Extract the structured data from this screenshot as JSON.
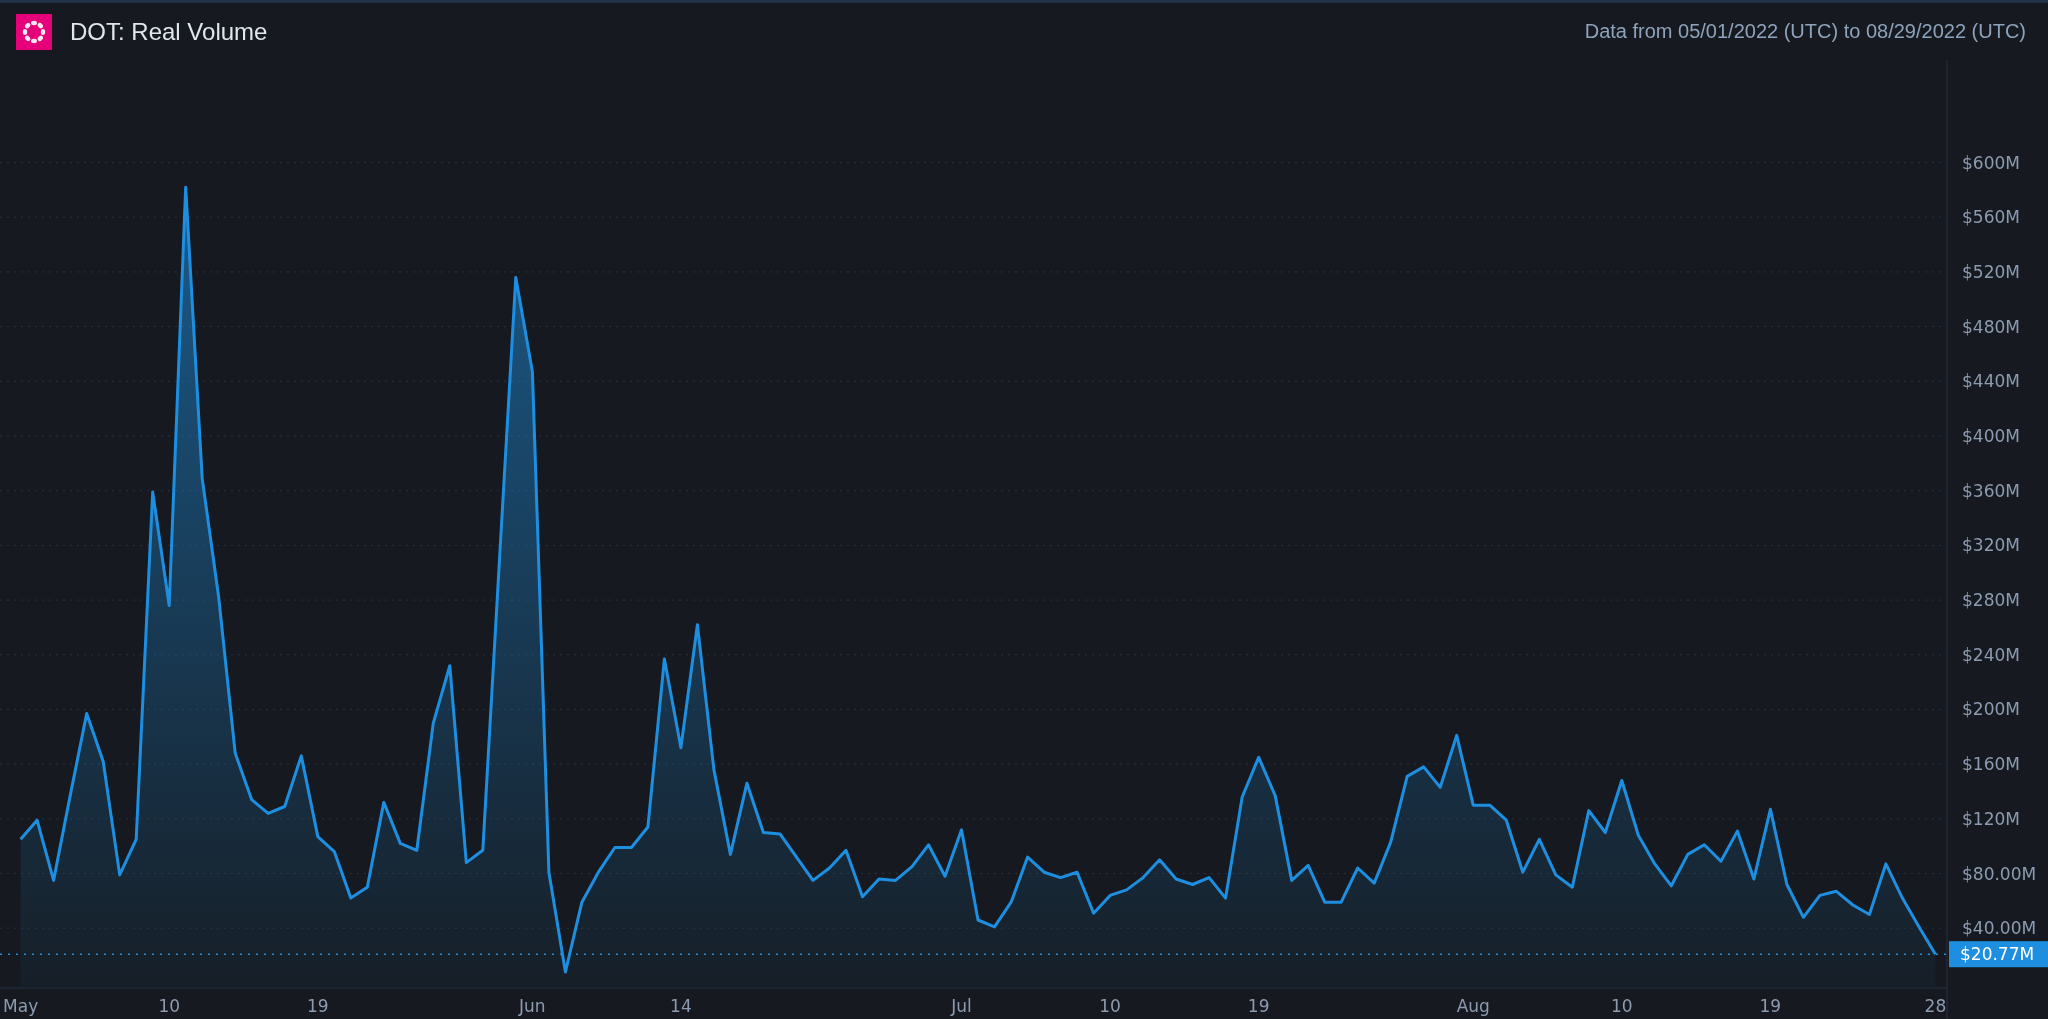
{
  "header": {
    "title": "DOT: Real Volume",
    "date_range": "Data from 05/01/2022 (UTC) to 08/29/2022 (UTC)"
  },
  "chart": {
    "chart_data": {
      "type": "area",
      "grid": true,
      "categories": [
        "May",
        null,
        null,
        null,
        null,
        null,
        null,
        null,
        null,
        "10",
        null,
        null,
        null,
        null,
        null,
        null,
        null,
        null,
        "19",
        null,
        null,
        null,
        null,
        null,
        null,
        null,
        null,
        null,
        null,
        null,
        null,
        "Jun",
        null,
        null,
        null,
        null,
        null,
        null,
        null,
        null,
        "14",
        null,
        null,
        null,
        null,
        null,
        null,
        null,
        null,
        null,
        null,
        null,
        null,
        null,
        null,
        null,
        null,
        "Jul",
        null,
        null,
        null,
        null,
        null,
        null,
        null,
        null,
        "10",
        null,
        null,
        null,
        null,
        null,
        null,
        null,
        null,
        "19",
        null,
        null,
        null,
        null,
        null,
        null,
        null,
        null,
        null,
        null,
        null,
        null,
        "Aug",
        null,
        null,
        null,
        null,
        null,
        null,
        null,
        null,
        "10",
        null,
        null,
        null,
        null,
        null,
        null,
        null,
        null,
        "19",
        null,
        null,
        null,
        null,
        null,
        null,
        null,
        null,
        null,
        "28"
      ],
      "ref_lines": [
        {
          "axis": "y",
          "value": 21,
          "label": "$20.77M",
          "color": "#1e8fe0"
        }
      ],
      "series": [
        {
          "color": "#1e8fe0",
          "values": [
            105,
            119,
            75,
            137,
            197,
            162,
            79,
            105,
            359,
            276,
            582,
            369,
            282,
            168,
            134,
            124,
            129,
            166,
            107,
            96,
            62,
            70,
            132,
            102,
            97,
            190,
            232,
            88,
            97,
            307,
            516,
            447,
            81,
            8,
            59,
            81,
            99,
            99,
            114,
            237,
            172,
            262,
            156,
            94,
            146,
            110,
            109,
            92,
            75,
            84,
            97,
            63,
            76,
            75,
            85,
            101,
            78,
            112,
            46,
            41,
            59,
            92,
            81,
            77,
            81,
            51,
            64,
            68,
            77,
            90,
            76,
            72,
            77,
            62,
            136,
            165,
            137,
            75,
            86,
            59,
            59,
            84,
            73,
            103,
            151,
            158,
            143,
            181,
            130,
            130,
            119,
            81,
            105,
            79,
            70,
            126,
            110,
            148,
            108,
            87,
            71,
            94,
            101,
            89,
            111,
            76,
            127,
            72,
            48,
            64,
            67,
            57,
            50,
            87,
            62,
            41,
            21
          ]
        }
      ],
      "ylim": [
        -3,
        675
      ],
      "yticks": [
        {
          "value": 40,
          "label": "$40.00M"
        },
        {
          "value": 80,
          "label": "$80.00M"
        },
        {
          "value": 120,
          "label": "$120M"
        },
        {
          "value": 160,
          "label": "$160M"
        },
        {
          "value": 200,
          "label": "$200M"
        },
        {
          "value": 240,
          "label": "$240M"
        },
        {
          "value": 280,
          "label": "$280M"
        },
        {
          "value": 320,
          "label": "$320M"
        },
        {
          "value": 360,
          "label": "$360M"
        },
        {
          "value": 400,
          "label": "$400M"
        },
        {
          "value": 440,
          "label": "$440M"
        },
        {
          "value": 480,
          "label": "$480M"
        },
        {
          "value": 520,
          "label": "$520M"
        },
        {
          "value": 560,
          "label": "$560M"
        },
        {
          "value": 600,
          "label": "$600M"
        }
      ]
    }
  }
}
